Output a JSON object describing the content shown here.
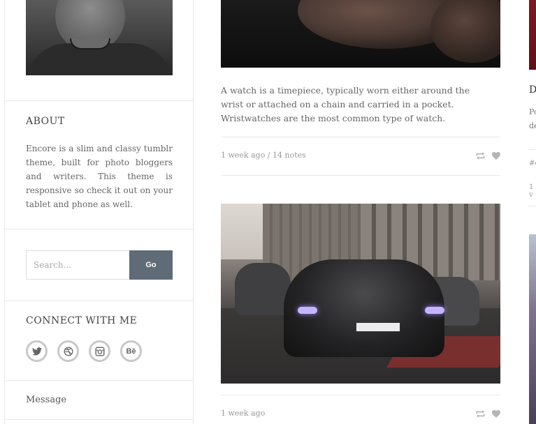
{
  "sidebar": {
    "about_title": "ABOUT",
    "about_text": "Encore is a slim and classy tumblr theme, built for photo bloggers and writers. This theme is responsive so check it out on your tablet and phone as well.",
    "search_placeholder": "Search...",
    "search_button": "Go",
    "connect_title": "CONNECT WITH ME",
    "social": [
      {
        "icon": "twitter-icon"
      },
      {
        "icon": "dribbble-icon"
      },
      {
        "icon": "instagram-icon"
      },
      {
        "icon": "behance-icon",
        "text": "Bē"
      }
    ],
    "message_label": "Message"
  },
  "posts": [
    {
      "text": "A watch is a timepiece, typically worn either around the wrist or attached on a chain and carried in a pocket. Wristwatches are the most common type of watch.",
      "meta": "1 week ago / 14 notes"
    },
    {
      "meta": "1 week ago"
    }
  ],
  "right_col": {
    "title_letter": "D",
    "line1": "Po",
    "line2": "de",
    "tag": "#c",
    "meta": "1 v"
  },
  "colors": {
    "accent": "#5f6b77",
    "text": "#666666",
    "meta": "#999999"
  }
}
